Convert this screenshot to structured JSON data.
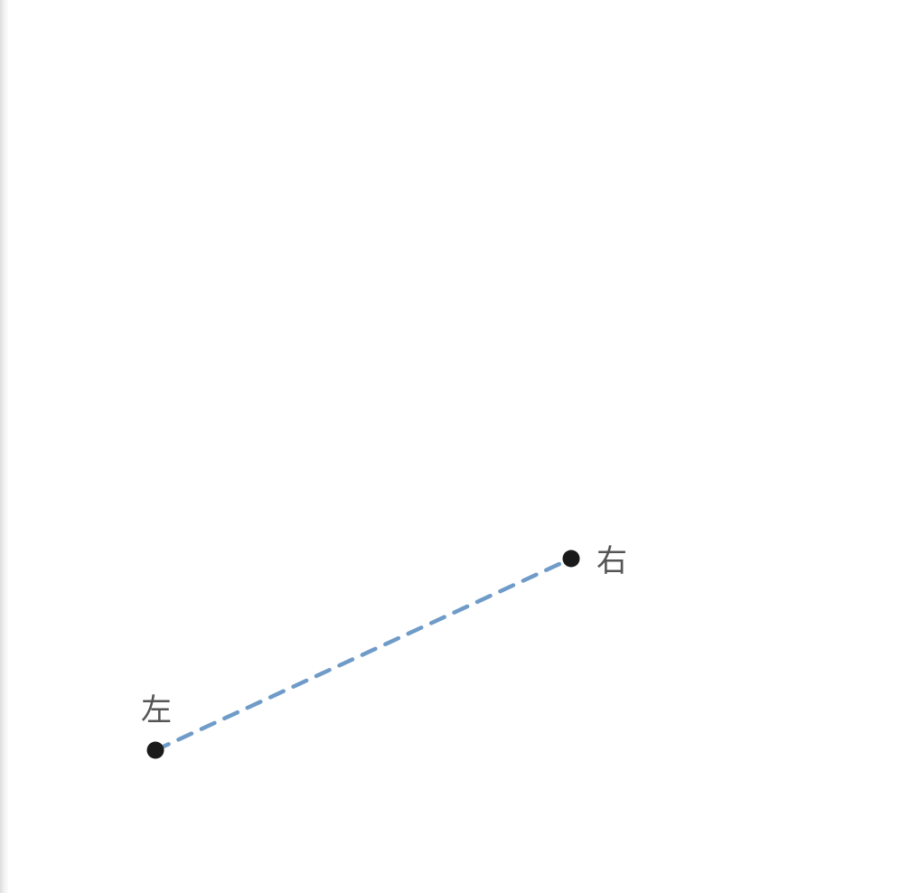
{
  "diagram": {
    "points": [
      {
        "id": "left",
        "label": "左"
      },
      {
        "id": "right",
        "label": "右"
      }
    ],
    "connection": {
      "from": "left",
      "to": "right",
      "style": "dashed",
      "color": "#6f9bc8"
    },
    "point_color": "#1a1a1a",
    "label_color": "#555555",
    "background": "#ffffff"
  }
}
